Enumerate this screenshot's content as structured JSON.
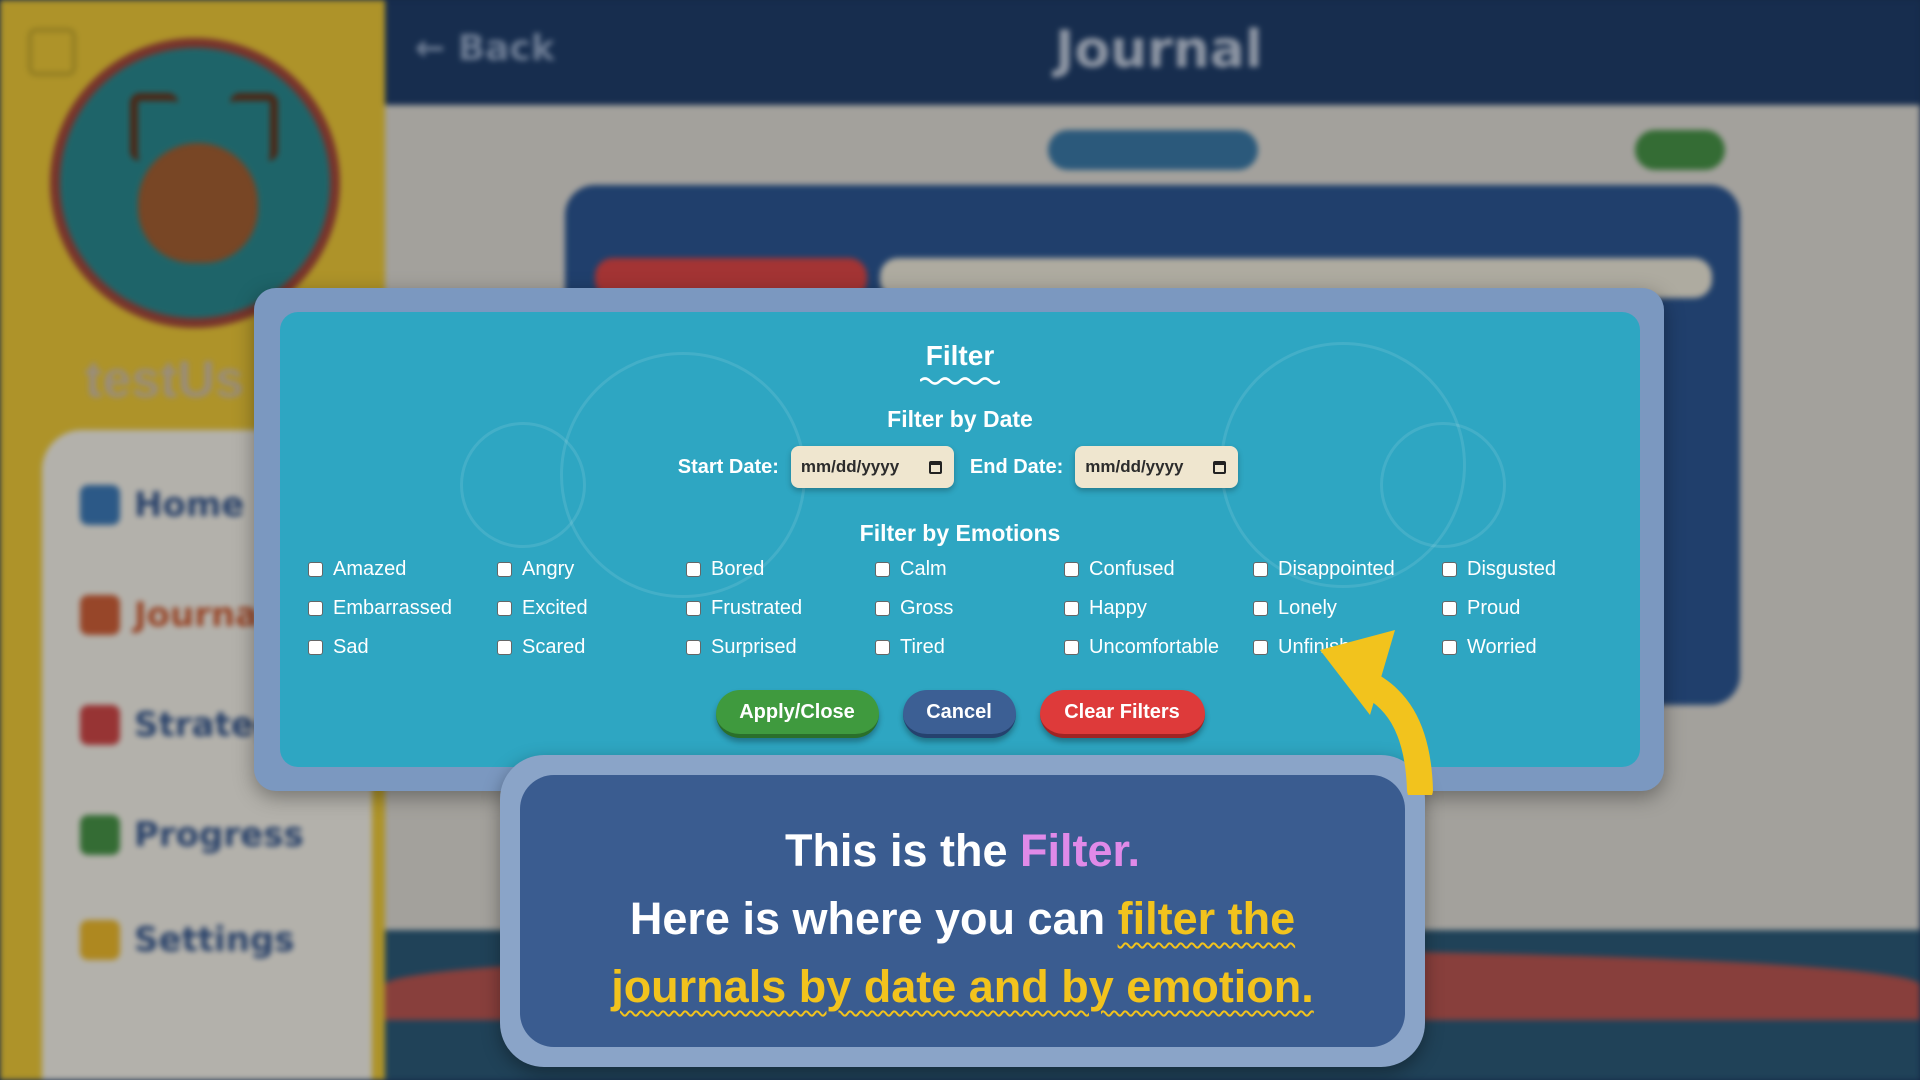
{
  "background": {
    "username": "testUs",
    "nav": [
      {
        "label": "Home",
        "color": "#2f6fb0"
      },
      {
        "label": "Journal",
        "color": "#c8542a"
      },
      {
        "label": "Strategies",
        "color": "#c83a3a"
      },
      {
        "label": "Progress",
        "color": "#3a8a3a"
      },
      {
        "label": "Settings",
        "color": "#e8b21e"
      }
    ],
    "back_label": "Back",
    "page_title": "Journal"
  },
  "filter_modal": {
    "title": "Filter",
    "date_section_title": "Filter by Date",
    "start_date_label": "Start Date:",
    "start_date_placeholder": "mm/dd/yyyy",
    "end_date_label": "End Date:",
    "end_date_placeholder": "mm/dd/yyyy",
    "emotion_section_title": "Filter by Emotions",
    "emotions": [
      "Amazed",
      "Angry",
      "Bored",
      "Calm",
      "Confused",
      "Disappointed",
      "Disgusted",
      "Embarrassed",
      "Excited",
      "Frustrated",
      "Gross",
      "Happy",
      "Lonely",
      "Proud",
      "Sad",
      "Scared",
      "Surprised",
      "Tired",
      "Uncomfortable",
      "Unfinished",
      "Worried"
    ],
    "buttons": {
      "apply": "Apply/Close",
      "cancel": "Cancel",
      "clear": "Clear Filters"
    }
  },
  "tutorial": {
    "line1_prefix": "This is the ",
    "line1_highlight": "Filter.",
    "line2_prefix": "Here is where you can ",
    "line2_highlight": "filter the",
    "line3_highlight": "journals by date and by emotion."
  },
  "colors": {
    "modal_bg": "#2ea6c2",
    "callout_bg": "#3a5c90",
    "highlight_pink": "#e08ae8",
    "highlight_yellow": "#f2c31d",
    "apply_green": "#3f9a3e",
    "cancel_blue": "#3c5f94",
    "clear_red": "#de3a3a"
  }
}
